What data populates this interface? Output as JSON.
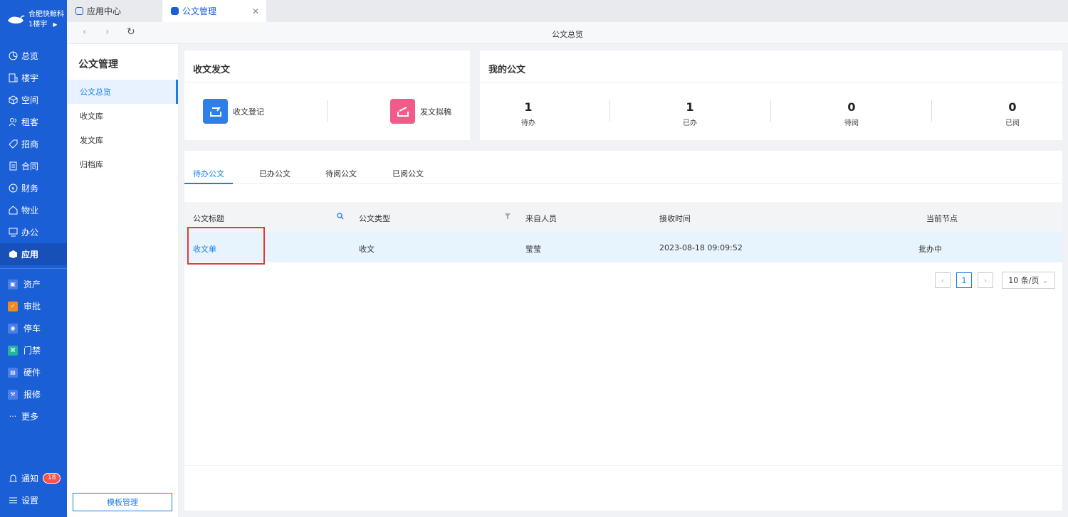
{
  "sidebar": {
    "org_name": "合肥快鲸科",
    "building": "1楼宇",
    "nav": [
      {
        "label": "总览",
        "icon": "dashboard-icon"
      },
      {
        "label": "楼宇",
        "icon": "building-icon"
      },
      {
        "label": "空间",
        "icon": "cube-icon"
      },
      {
        "label": "租客",
        "icon": "users-icon"
      },
      {
        "label": "招商",
        "icon": "tag-icon"
      },
      {
        "label": "合同",
        "icon": "contract-icon"
      },
      {
        "label": "财务",
        "icon": "finance-icon"
      },
      {
        "label": "物业",
        "icon": "home-icon"
      },
      {
        "label": "办公",
        "icon": "monitor-icon"
      },
      {
        "label": "应用",
        "icon": "app-icon"
      }
    ],
    "apps": [
      {
        "label": "资产",
        "color": "#4a7de8"
      },
      {
        "label": "审批",
        "color": "#f08a24"
      },
      {
        "label": "停车",
        "color": "#4a7de8"
      },
      {
        "label": "门禁",
        "color": "#22b59a"
      },
      {
        "label": "硬件",
        "color": "#4a7de8"
      },
      {
        "label": "报修",
        "color": "#4a7de8"
      }
    ],
    "more": "更多",
    "notice": "通知",
    "notice_count": "18",
    "settings": "设置"
  },
  "tabs": [
    {
      "label": "应用中心"
    },
    {
      "label": "公文管理"
    }
  ],
  "toolbar": {
    "title": "公文总览"
  },
  "subnav": {
    "title": "公文管理",
    "items": [
      "公文总览",
      "收文库",
      "发文库",
      "归档库"
    ],
    "template_button": "模板管理"
  },
  "send_receive": {
    "title": "收文发文",
    "register": "收文登记",
    "draft": "发文拟稿"
  },
  "my_docs": {
    "title": "我的公文",
    "stats": [
      {
        "value": "1",
        "label": "待办"
      },
      {
        "value": "1",
        "label": "已办"
      },
      {
        "value": "0",
        "label": "待阅"
      },
      {
        "value": "0",
        "label": "已阅"
      }
    ]
  },
  "doc_tabs": [
    "待办公文",
    "已办公文",
    "待阅公文",
    "已阅公文"
  ],
  "table": {
    "columns": [
      "公文标题",
      "公文类型",
      "来自人员",
      "接收时间",
      "当前节点"
    ],
    "rows": [
      [
        "收文单",
        "收文",
        "莹莹",
        "2023-08-18 09:09:52",
        "批办中"
      ]
    ]
  },
  "pagination": {
    "current": "1",
    "page_size": "10 条/页"
  }
}
